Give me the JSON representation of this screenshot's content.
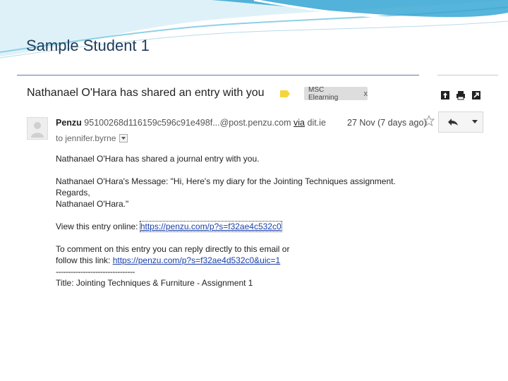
{
  "slide": {
    "title": "Sample Student 1"
  },
  "email": {
    "subject": "Nathanael O'Hara has shared an entry with you",
    "label_chip": {
      "text": "MSC Elearning",
      "remove": "x"
    },
    "sender": {
      "name": "Penzu",
      "address": "95100268d116159c596c91e498f...@post.penzu.com",
      "via_label": "via",
      "via_domain": "dit.ie"
    },
    "to": "to jennifer.byrne",
    "date": "27 Nov (7 days ago)",
    "body": {
      "line1": "Nathanael O'Hara has shared a journal entry with you.",
      "line2": "Nathanael O'Hara's Message: \"Hi, Here's my diary for the Jointing Techniques assignment.",
      "line3": "Regards,",
      "line4": "Nathanael O'Hara.\"",
      "view_prefix": "View this entry online: ",
      "view_link": "https://penzu.com/p?s=f32ae4c532c0",
      "comment_line1": "To comment on this entry you can reply directly to this email or",
      "comment_prefix": "follow this link: ",
      "comment_link": "https://penzu.com/p?s=f32ae4d532c0&uic=1",
      "separator": "--------------------------------",
      "title_line": "Title: Jointing Techniques & Furniture - Assignment 1"
    }
  },
  "icons": {
    "label": "label-tag-icon",
    "star": "star-icon",
    "reply": "reply-icon",
    "more": "chevron-down-icon",
    "print": "print-icon",
    "open": "open-new-window-icon",
    "archive": "archive-up-icon"
  },
  "colors": {
    "label_tag": "#f5d53d",
    "link": "#1a3fa8",
    "title_text": "#1f3b5a"
  }
}
